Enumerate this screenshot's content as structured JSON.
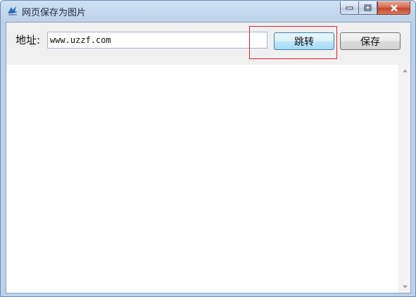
{
  "window": {
    "title": "网页保存为图片",
    "icon": "app-icon"
  },
  "toolbar": {
    "address_label": "地址:",
    "address_value": "www.uzzf.com",
    "go_label": "跳转",
    "save_label": "保存"
  },
  "colors": {
    "highlight": "#e0202a",
    "go_button_border": "#3c7fb1"
  }
}
